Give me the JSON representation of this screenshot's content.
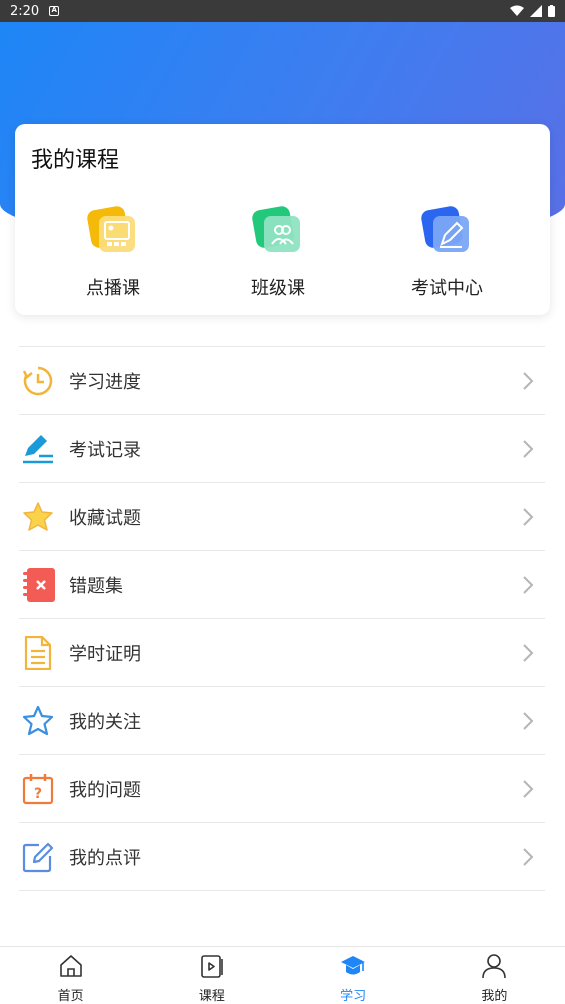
{
  "status_bar": {
    "time": "2:20"
  },
  "course_card": {
    "title": "我的课程",
    "entries": [
      {
        "label": "点播课",
        "icon": "video-lecture-icon",
        "color": "#f5b90a"
      },
      {
        "label": "班级课",
        "icon": "class-group-icon",
        "color": "#22c97a"
      },
      {
        "label": "考试中心",
        "icon": "exam-pen-icon",
        "color": "#2a66f0"
      }
    ]
  },
  "menu": {
    "items": [
      {
        "label": "学习进度",
        "icon": "clock-progress-icon",
        "color": "#f2b43a"
      },
      {
        "label": "考试记录",
        "icon": "pen-record-icon",
        "color": "#1a9bd8"
      },
      {
        "label": "收藏试题",
        "icon": "star-filled-icon",
        "color": "#f7c52b"
      },
      {
        "label": "错题集",
        "icon": "wrong-notebook-icon",
        "color": "#f25c54"
      },
      {
        "label": "学时证明",
        "icon": "document-icon",
        "color": "#f2b43a"
      },
      {
        "label": "我的关注",
        "icon": "star-outline-icon",
        "color": "#3a8fe0"
      },
      {
        "label": "我的问题",
        "icon": "calendar-question-icon",
        "color": "#f07a3c"
      },
      {
        "label": "我的点评",
        "icon": "edit-comment-icon",
        "color": "#5a8de0"
      }
    ]
  },
  "tab_bar": {
    "active": "学习",
    "tabs": [
      {
        "label": "首页",
        "icon": "home-icon"
      },
      {
        "label": "课程",
        "icon": "course-play-icon"
      },
      {
        "label": "学习",
        "icon": "graduation-cap-icon"
      },
      {
        "label": "我的",
        "icon": "user-icon"
      }
    ]
  }
}
